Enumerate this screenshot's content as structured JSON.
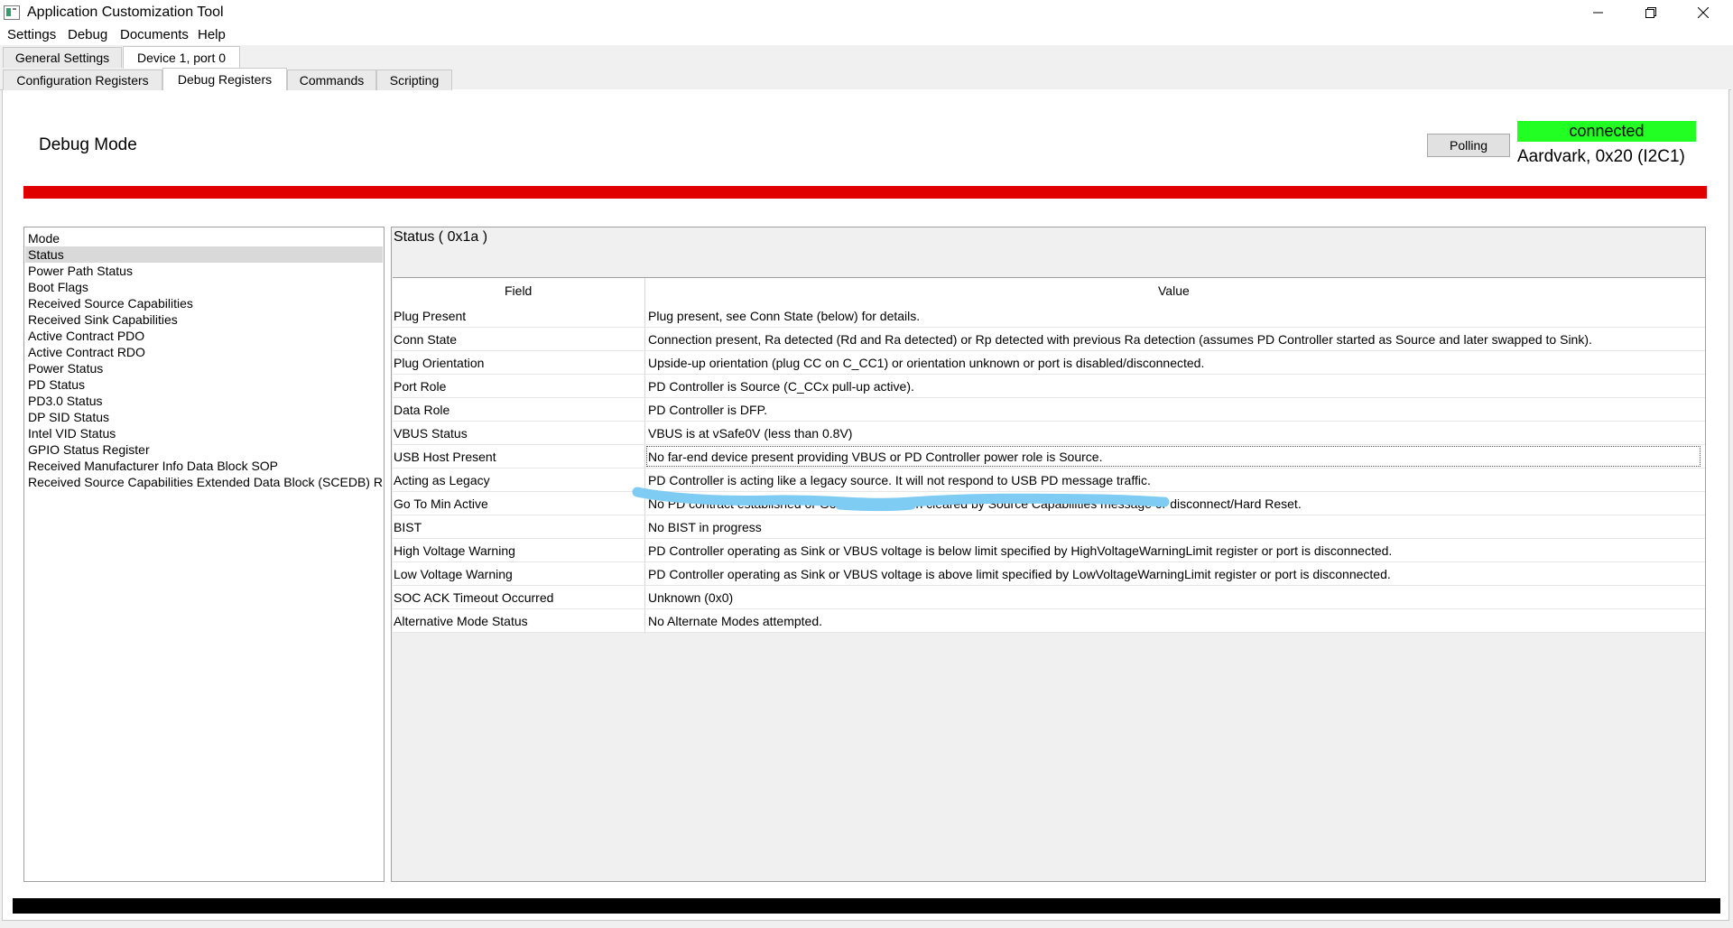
{
  "window": {
    "title": "Application Customization Tool"
  },
  "menu": [
    "Settings",
    "Debug",
    "Documents",
    "Help"
  ],
  "top_tabs": [
    {
      "label": "General Settings",
      "active": false
    },
    {
      "label": "Device 1, port 0",
      "active": true
    }
  ],
  "sub_tabs": [
    {
      "label": "Configuration Registers",
      "active": false
    },
    {
      "label": "Debug Registers",
      "active": true
    },
    {
      "label": "Commands",
      "active": false
    },
    {
      "label": "Scripting",
      "active": false
    }
  ],
  "header": {
    "title": "Debug Mode",
    "polling_label": "Polling",
    "status": "connected",
    "connection_info": "Aardvark, 0x20 (I2C1)"
  },
  "colors": {
    "status_green": "#22ff22",
    "error_bar": "#e00000",
    "scribble": "#7ecbf3"
  },
  "register_list": {
    "selected_index": 1,
    "items": [
      "Mode",
      "Status",
      "Power Path Status",
      "Boot Flags",
      "Received Source Capabilities",
      "Received Sink Capabilities",
      "Active Contract PDO",
      "Active Contract RDO",
      "Power Status",
      "PD Status",
      "PD3.0 Status",
      "DP SID Status",
      "Intel VID Status",
      "GPIO Status Register",
      "Received Manufacturer Info Data Block SOP",
      "Received Source Capabilities Extended Data Block (SCEDB) R"
    ]
  },
  "register_panel": {
    "title": "Status  ( 0x1a )",
    "headers": {
      "field": "Field",
      "value": "Value"
    },
    "rows": [
      {
        "field": "Plug Present",
        "value": "Plug present, see Conn State (below) for details."
      },
      {
        "field": "Conn State",
        "value": "Connection present, Ra detected (Rd and Ra detected) or Rp detected with previous Ra detection (assumes PD Controller started as Source and later swapped to Sink)."
      },
      {
        "field": "Plug Orientation",
        "value": "Upside-up orientation (plug CC on C_CC1) or orientation unknown or port is disabled/disconnected."
      },
      {
        "field": "Port Role",
        "value": "PD Controller is Source (C_CCx pull-up active)."
      },
      {
        "field": "Data Role",
        "value": "PD Controller is DFP."
      },
      {
        "field": "VBUS Status",
        "value": "VBUS is at vSafe0V (less than 0.8V)"
      },
      {
        "field": "USB Host Present",
        "value": "No far-end device present providing VBUS or PD Controller power role is Source."
      },
      {
        "field": "Acting as Legacy",
        "value": "PD Controller is acting like a legacy source. It will not respond to USB PD message traffic."
      },
      {
        "field": "Go To Min Active",
        "value": "No PD contract established or GotoMin has been cleared by Source Capabilities message or disconnect/Hard Reset."
      },
      {
        "field": "BIST",
        "value": "No BIST in progress"
      },
      {
        "field": "High Voltage Warning",
        "value": "PD Controller operating as Sink or VBUS voltage is below limit specified by HighVoltageWarningLimit register or port is disconnected."
      },
      {
        "field": "Low Voltage Warning",
        "value": "PD Controller operating as Sink or VBUS voltage is above limit specified by LowVoltageWarningLimit register or port is disconnected."
      },
      {
        "field": "SOC ACK Timeout Occurred",
        "value": "Unknown (0x0)"
      },
      {
        "field": "Alternative Mode Status",
        "value": "No Alternate Modes attempted."
      }
    ]
  }
}
